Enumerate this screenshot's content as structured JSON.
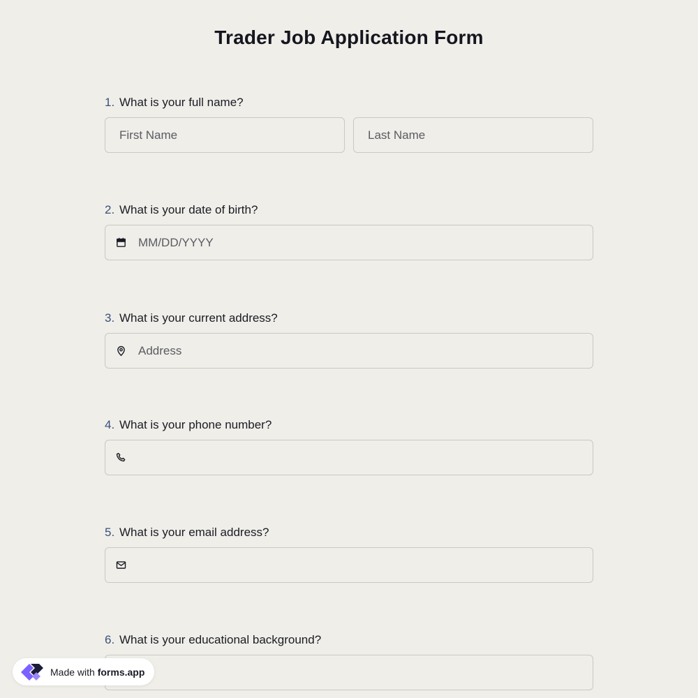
{
  "form": {
    "title": "Trader Job Application Form"
  },
  "questions": [
    {
      "number": "1.",
      "label": "What is your full name?",
      "fields": [
        {
          "placeholder": "First Name"
        },
        {
          "placeholder": "Last Name"
        }
      ]
    },
    {
      "number": "2.",
      "label": "What is your date of birth?",
      "icon": "calendar-icon",
      "placeholder": "MM/DD/YYYY"
    },
    {
      "number": "3.",
      "label": "What is your current address?",
      "icon": "map-pin-icon",
      "placeholder": "Address"
    },
    {
      "number": "4.",
      "label": "What is your phone number?",
      "icon": "phone-icon",
      "placeholder": ""
    },
    {
      "number": "5.",
      "label": "What is your email address?",
      "icon": "mail-icon",
      "placeholder": ""
    },
    {
      "number": "6.",
      "label": "What is your educational background?",
      "placeholder": ""
    }
  ],
  "badge": {
    "prefix": "Made with",
    "brand": "forms.app",
    "logo_icon": "forms-app-logo-icon"
  },
  "colors": {
    "background": "#efeee9",
    "question_number": "#3a4f7a",
    "logo_purple": "#7b61ff",
    "logo_dark": "#1b1b3a"
  }
}
